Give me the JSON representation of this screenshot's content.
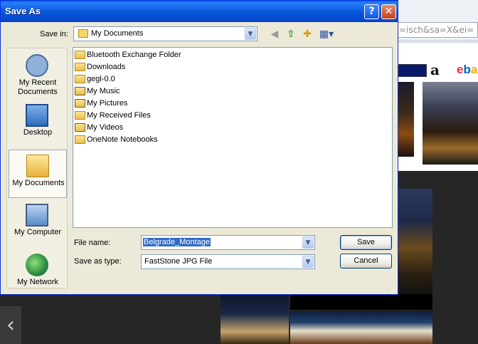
{
  "background": {
    "url_text": "=isch&sa=X&ei=",
    "amazon_logo": "a",
    "ebay_logo": [
      "e",
      "b",
      "a"
    ]
  },
  "dialog": {
    "title": "Save As",
    "help_glyph": "?",
    "close_glyph": "✕",
    "save_in_label": "Save in:",
    "save_in_value": "My Documents",
    "toolbar": {
      "back_icon": "back-arrow-icon",
      "up_icon": "up-folder-icon",
      "new_folder_icon": "new-folder-icon",
      "views_icon": "views-menu-icon"
    },
    "places": [
      {
        "name": "My Recent\nDocuments",
        "line1": "My Recent",
        "line2": "Documents",
        "icon": "recent-documents-icon"
      },
      {
        "name": "Desktop",
        "line1": "Desktop",
        "line2": "",
        "icon": "desktop-icon"
      },
      {
        "name": "My Documents",
        "line1": "My Documents",
        "line2": "",
        "icon": "my-documents-icon",
        "selected": true
      },
      {
        "name": "My Computer",
        "line1": "My Computer",
        "line2": "",
        "icon": "my-computer-icon"
      },
      {
        "name": "My Network",
        "line1": "My Network",
        "line2": "",
        "icon": "my-network-icon"
      }
    ],
    "files": [
      "Bluetooth Exchange Folder",
      "Downloads",
      "gegl-0.0",
      "My Music",
      "My Pictures",
      "My Received Files",
      "My Videos",
      "OneNote Notebooks"
    ],
    "file_name_label": "File name:",
    "file_name_value": "Belgrade_Montage",
    "save_type_label": "Save as type:",
    "save_type_value": "FastStone JPG File",
    "save_button": "Save",
    "cancel_button": "Cancel"
  }
}
